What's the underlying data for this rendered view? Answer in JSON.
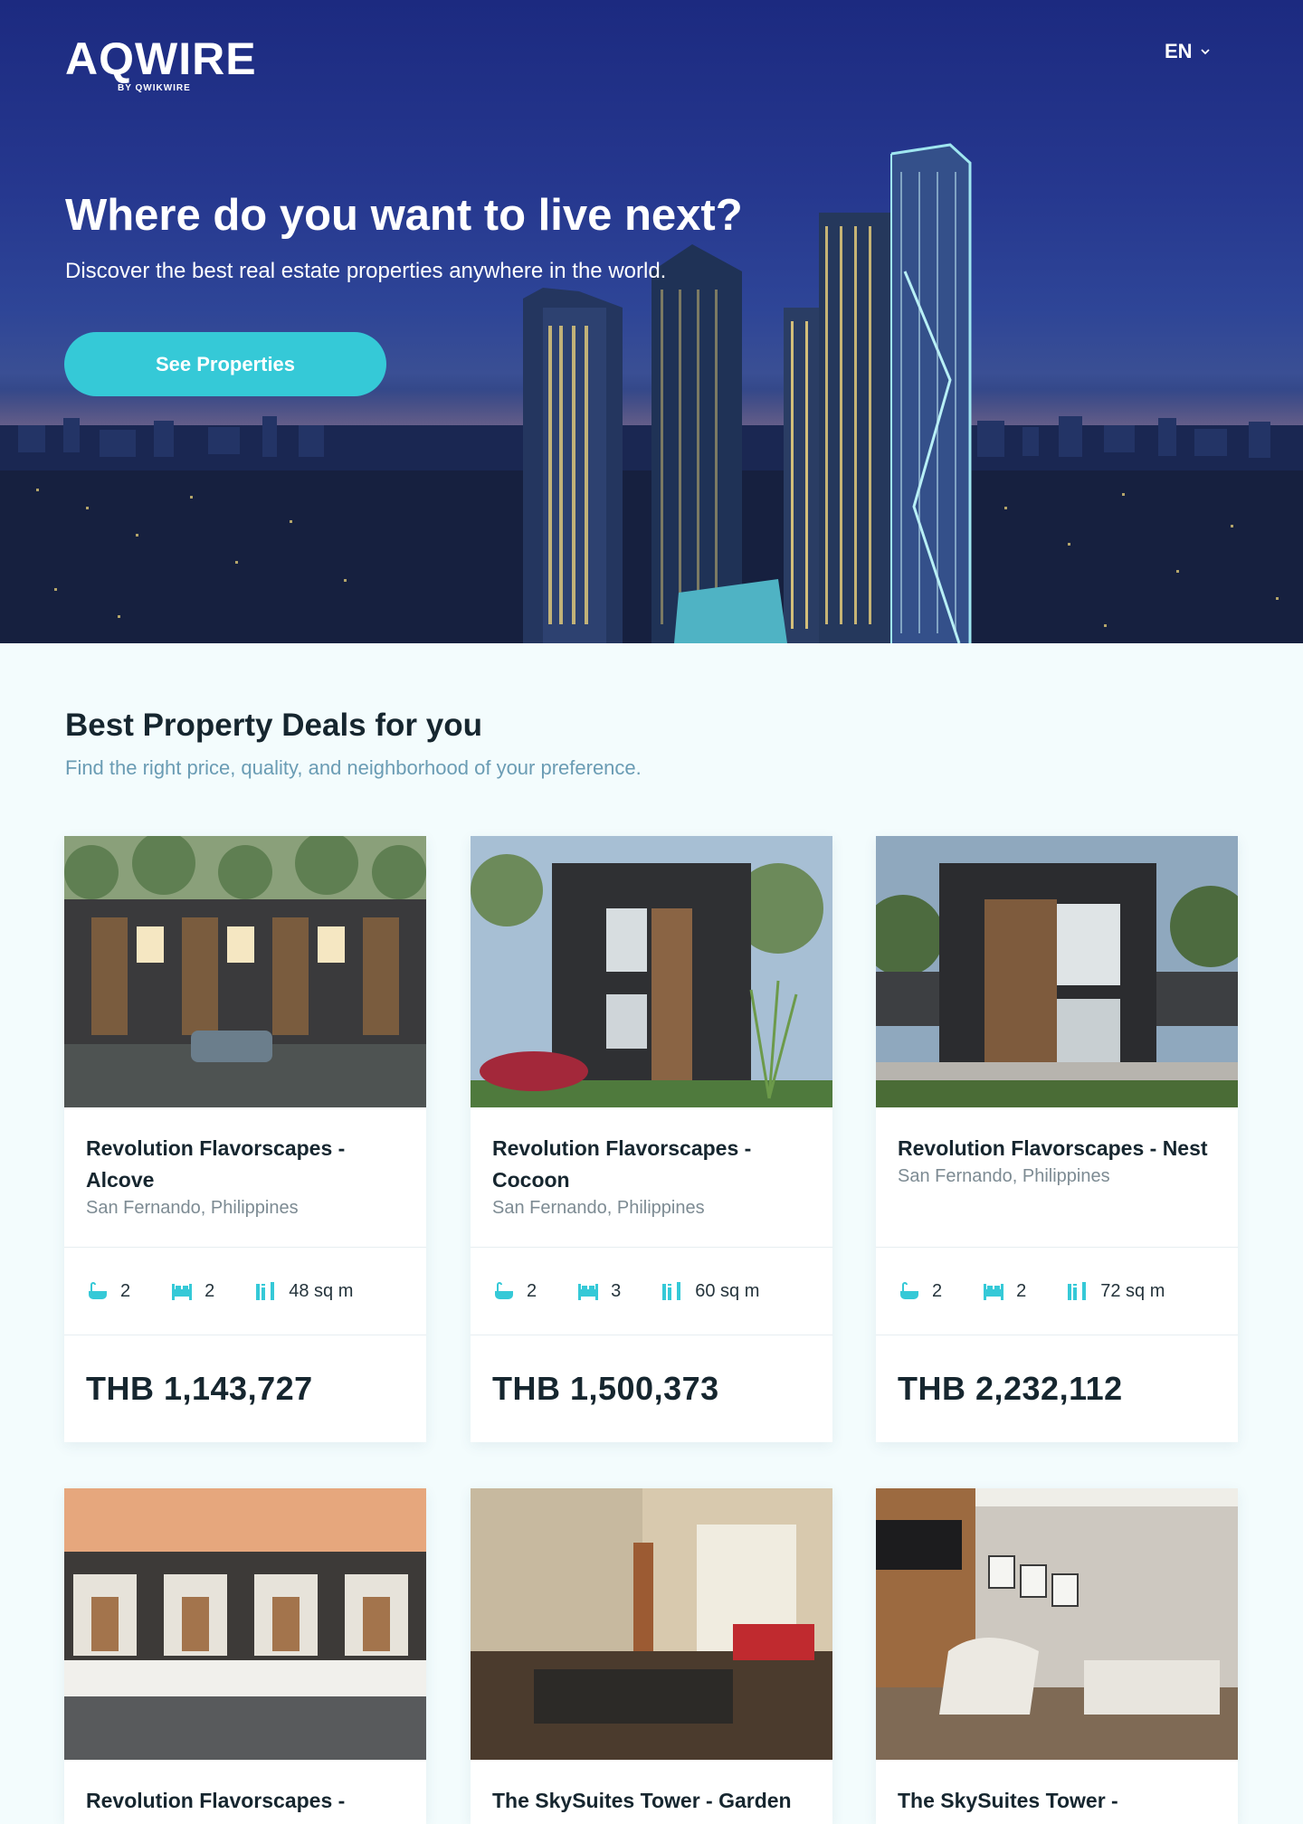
{
  "header": {
    "logo_text": "AQWIRE",
    "logo_byline": "BY QWIKWIRE",
    "language": "EN"
  },
  "hero": {
    "title": "Where do you want to live next?",
    "subtitle": "Discover the best real estate properties anywhere in the world.",
    "cta_label": "See Properties"
  },
  "deals": {
    "title": "Best Property Deals for you",
    "subtitle": "Find the right price, quality, and neighborhood of your preference."
  },
  "properties": [
    {
      "name": "Revolution Flavorscapes - Alcove",
      "location": "San Fernando, Philippines",
      "baths": "2",
      "beds": "2",
      "area": "48 sq m",
      "price": "THB 1,143,727"
    },
    {
      "name": "Revolution Flavorscapes - Cocoon",
      "location": "San Fernando, Philippines",
      "baths": "2",
      "beds": "3",
      "area": "60 sq m",
      "price": "THB 1,500,373"
    },
    {
      "name": "Revolution Flavorscapes - Nest",
      "location": "San Fernando, Philippines",
      "baths": "2",
      "beds": "2",
      "area": "72 sq m",
      "price": "THB 2,232,112"
    },
    {
      "name": "Revolution Flavorscapes -"
    },
    {
      "name": "The SkySuites Tower - Garden"
    },
    {
      "name": "The SkySuites Tower -"
    }
  ],
  "colors": {
    "accent": "#35c9d7",
    "hero_blue": "#26388f",
    "page_bg": "#f3fcfd",
    "subtitle_blue": "#6a9cb4"
  },
  "icons": {
    "bath": "bathtub-icon",
    "bed": "bed-icon",
    "area": "floor-area-icon",
    "language": "chevron-down-icon"
  }
}
